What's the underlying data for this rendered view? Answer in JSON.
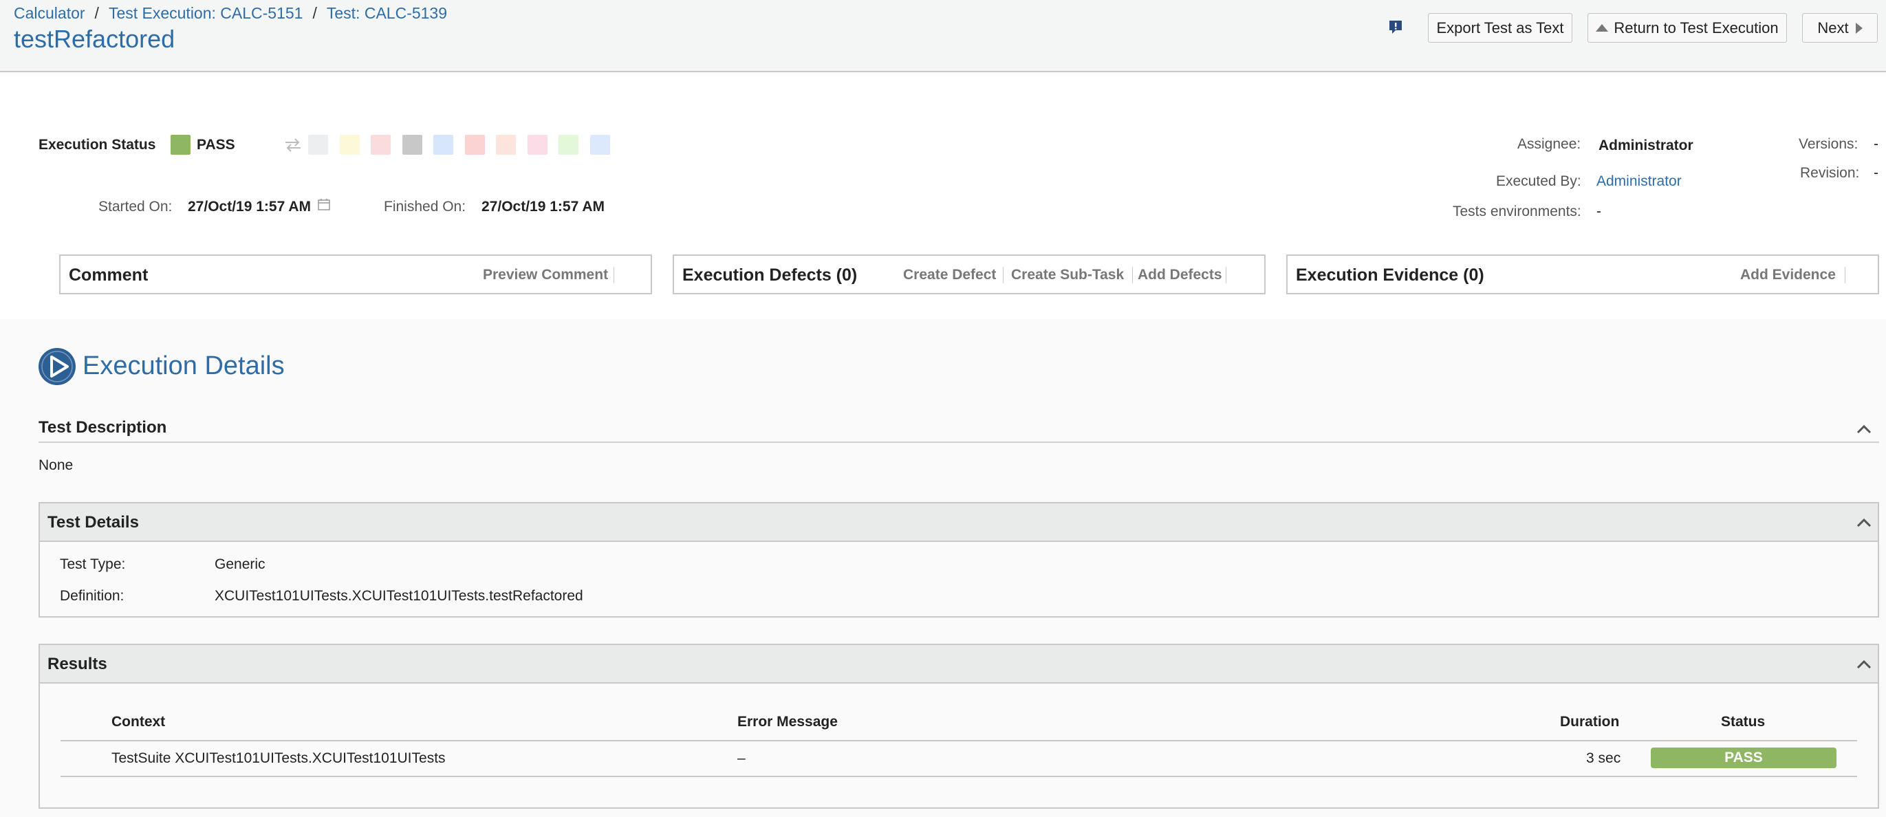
{
  "breadcrumb": {
    "items": [
      "Calculator",
      "Test Execution: CALC-5151",
      "Test: CALC-5139"
    ],
    "separator": "/"
  },
  "page_title": "testRefactored",
  "toolbar": {
    "export_label": "Export Test as Text",
    "return_label": "Return to Test Execution",
    "next_label": "Next"
  },
  "execution": {
    "status_label": "Execution Status",
    "status_value": "PASS",
    "status_color": "#8eb663",
    "started_label": "Started On:",
    "started_value": "27/Oct/19 1:57 AM",
    "finished_label": "Finished On:",
    "finished_value": "27/Oct/19 1:57 AM",
    "swatch_colors": [
      "#eceef0",
      "#fdf8d8",
      "#fadcdc",
      "#c8c8c8",
      "#d8e6fb",
      "#fbd3d3",
      "#fde4dc",
      "#fcdce6",
      "#e3f8d8",
      "#dce8fb"
    ]
  },
  "meta": {
    "assignee_label": "Assignee:",
    "assignee_value": "Administrator",
    "executed_by_label": "Executed By:",
    "executed_by_value": "Administrator",
    "envs_label": "Tests environments:",
    "envs_value": "-",
    "versions_label": "Versions:",
    "versions_value": "-",
    "revision_label": "Revision:",
    "revision_value": "-"
  },
  "panels": {
    "comment_title": "Comment",
    "preview_comment": "Preview Comment",
    "defects_title": "Execution Defects (0)",
    "create_defect": "Create Defect",
    "create_subtask": "Create Sub-Task",
    "add_defects": "Add Defects",
    "evidence_title": "Execution Evidence (0)",
    "add_evidence": "Add Evidence"
  },
  "details": {
    "heading": "Execution Details",
    "description_title": "Test Description",
    "description_value": "None",
    "test_details_title": "Test Details",
    "test_type_label": "Test Type:",
    "test_type_value": "Generic",
    "definition_label": "Definition:",
    "definition_value": "XCUITest101UITests.XCUITest101UITests.testRefactored"
  },
  "results": {
    "title": "Results",
    "columns": [
      "Context",
      "Error Message",
      "Duration",
      "Status"
    ],
    "rows": [
      {
        "context": "TestSuite XCUITest101UITests.XCUITest101UITests",
        "error": "–",
        "duration": "3 sec",
        "status": "PASS"
      }
    ]
  },
  "colors": {
    "accent": "#2e6ca8",
    "pass": "#8eb663"
  }
}
